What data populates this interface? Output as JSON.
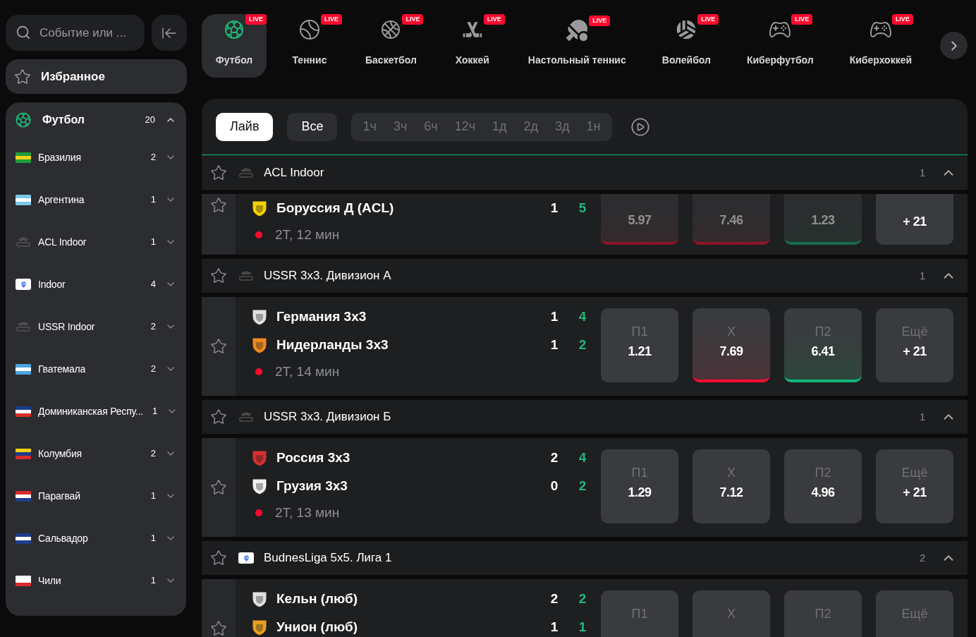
{
  "search": {
    "placeholder": "Событие или ..."
  },
  "favorites": {
    "label": "Избранное"
  },
  "sidebar": {
    "sport": {
      "label": "Футбол",
      "count": "20",
      "expanded": true
    },
    "items": [
      {
        "name": "Бразилия",
        "count": "2",
        "kind": "flag",
        "expanded": false
      },
      {
        "name": "Аргентина",
        "count": "1",
        "kind": "flag",
        "expanded": false
      },
      {
        "name": "ACL Indoor",
        "count": "1",
        "kind": "logo",
        "expanded": false
      },
      {
        "name": "Indoor",
        "count": "4",
        "kind": "pin",
        "expanded": false
      },
      {
        "name": "USSR Indoor",
        "count": "2",
        "kind": "logo",
        "expanded": false
      },
      {
        "name": "Гватемала",
        "count": "2",
        "kind": "flag",
        "expanded": false
      },
      {
        "name": "Доминиканская Респу...",
        "count": "1",
        "kind": "flag",
        "expanded": false
      },
      {
        "name": "Колумбия",
        "count": "2",
        "kind": "flag",
        "expanded": false
      },
      {
        "name": "Парагвай",
        "count": "1",
        "kind": "flag",
        "expanded": false
      },
      {
        "name": "Сальвадор",
        "count": "1",
        "kind": "flag",
        "expanded": false
      },
      {
        "name": "Чили",
        "count": "1",
        "kind": "flag",
        "expanded": false
      }
    ]
  },
  "sports_tabs": [
    {
      "label": "Футбол",
      "kind": "football",
      "badge": "LIVE",
      "selected": true
    },
    {
      "label": "Теннис",
      "kind": "tennis",
      "badge": "LIVE",
      "selected": false
    },
    {
      "label": "Баскетбол",
      "kind": "basketball",
      "badge": "LIVE",
      "selected": false
    },
    {
      "label": "Хоккей",
      "kind": "hockey",
      "badge": "LIVE",
      "selected": false
    },
    {
      "label": "Настольный теннис",
      "kind": "tabletennis",
      "badge": "LIVE",
      "selected": false
    },
    {
      "label": "Волейбол",
      "kind": "volleyball",
      "badge": "LIVE",
      "selected": false
    },
    {
      "label": "Киберфутбол",
      "kind": "cyber",
      "badge": "LIVE",
      "selected": false
    },
    {
      "label": "Киберхоккей",
      "kind": "cyber",
      "badge": "LIVE",
      "selected": false
    }
  ],
  "filters": [
    {
      "label": "Лайв",
      "selected": true
    },
    {
      "label": "Все",
      "selected": false
    }
  ],
  "periods": [
    {
      "label": "1ч",
      "selected": false
    },
    {
      "label": "3ч",
      "selected": false
    },
    {
      "label": "6ч",
      "selected": false
    },
    {
      "label": "12ч",
      "selected": false
    },
    {
      "label": "1д",
      "selected": false
    },
    {
      "label": "2д",
      "selected": false
    },
    {
      "label": "3д",
      "selected": false
    },
    {
      "label": "1н",
      "selected": false
    }
  ],
  "groups": [
    {
      "name": "ACL Indoor",
      "kind": "logo",
      "count": "1",
      "expanded": true,
      "events": [
        {
          "clipped": true,
          "status": "2Т, 12 мин",
          "teams": [
            {
              "name": "Боруссия Д (ACL)",
              "color": "#f5d000",
              "score": "1",
              "current": "5"
            }
          ],
          "odds": [
            {
              "value": "5.97",
              "down": true,
              "up": false,
              "dimmed": true
            },
            {
              "value": "7.46",
              "down": true,
              "up": false,
              "dimmed": true
            },
            {
              "value": "1.23",
              "down": false,
              "up": true,
              "dimmed": true
            },
            {
              "value": "+ 21",
              "down": false,
              "up": false,
              "dimmed": false
            }
          ]
        }
      ]
    },
    {
      "name": "USSR 3x3. Дивизион А",
      "kind": "logo",
      "count": "1",
      "expanded": true,
      "events": [
        {
          "clipped": false,
          "status": "2Т, 14 мин",
          "teams": [
            {
              "name": "Германия 3x3",
              "color": "#e0e0e0",
              "score": "1",
              "current": "4"
            },
            {
              "name": "Нидерланды 3x3",
              "color": "#f08a1c",
              "score": "1",
              "current": "2"
            }
          ],
          "odds": [
            {
              "label": "П1",
              "value": "1.21",
              "down": false,
              "up": false,
              "dimmed": false
            },
            {
              "label": "X",
              "value": "7.69",
              "down": true,
              "up": false,
              "dimmed": false
            },
            {
              "label": "П2",
              "value": "6.41",
              "down": false,
              "up": true,
              "dimmed": false
            },
            {
              "label": "Ещё",
              "value": "+ 21",
              "down": false,
              "up": false,
              "dimmed": false
            }
          ]
        }
      ]
    },
    {
      "name": "USSR 3x3. Дивизион Б",
      "kind": "logo",
      "count": "1",
      "expanded": true,
      "events": [
        {
          "clipped": false,
          "status": "2Т, 13 мин",
          "teams": [
            {
              "name": "Россия 3x3",
              "color": "#d63030",
              "score": "2",
              "current": "4"
            },
            {
              "name": "Грузия 3x3",
              "color": "#f2f2f2",
              "score": "0",
              "current": "2"
            }
          ],
          "odds": [
            {
              "label": "П1",
              "value": "1.29",
              "down": false,
              "up": false,
              "dimmed": false
            },
            {
              "label": "X",
              "value": "7.12",
              "down": false,
              "up": false,
              "dimmed": false
            },
            {
              "label": "П2",
              "value": "4.96",
              "down": false,
              "up": false,
              "dimmed": false
            },
            {
              "label": "Ещё",
              "value": "+ 21",
              "down": false,
              "up": false,
              "dimmed": false
            }
          ]
        }
      ]
    },
    {
      "name": "BudnesLiga 5x5. Лига 1",
      "kind": "pin",
      "count": "2",
      "expanded": true,
      "events": [
        {
          "clipped": false,
          "teams": [
            {
              "name": "Кельн (люб)",
              "color": "#e0e0e0",
              "score": "2",
              "current": "2"
            },
            {
              "name": "Унион (люб)",
              "color": "#e8a020",
              "score": "1",
              "current": "1"
            }
          ],
          "odds": [
            {
              "label": "П1"
            },
            {
              "label": "X"
            },
            {
              "label": "П2"
            },
            {
              "label": "Ещё"
            }
          ]
        }
      ]
    }
  ]
}
